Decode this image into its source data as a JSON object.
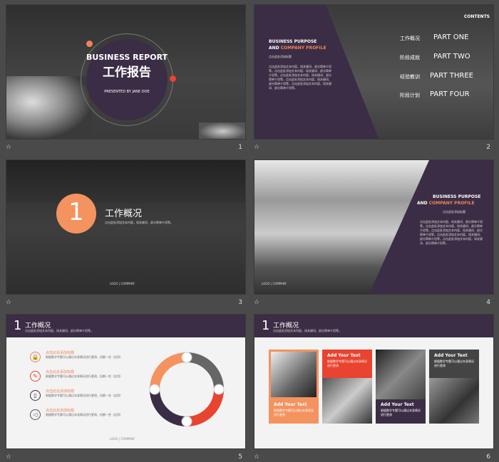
{
  "slides": [
    {
      "num": "1",
      "title_en": "BUSINESS REPORT",
      "title_cn": "工作报告",
      "presenter": "PRESENTED  BY  JANE  DOE"
    },
    {
      "num": "2",
      "contents": "CONTENTS",
      "heading1": "BUSINESS PURPOSE",
      "heading2a": "AND",
      "heading2b": "COMPANY PROFILE",
      "desc": "点击此处添加标题",
      "body": "点击此处添加文本内容，如关键词、部分简单介绍等。点击此处添加文本内容，如关键词、部分简单介绍等。点击此处添加文本内容，如关键词、部分简单介绍等。点击此处添加文本内容，如关键词、部分简单介绍等。点击此处添加文本内容，如关键词、部分简单介绍等。",
      "items": [
        {
          "cn": "工作概况",
          "en": "PART ONE"
        },
        {
          "cn": "阶段成就",
          "en": "PART TWO"
        },
        {
          "cn": "经验教训",
          "en": "PART THREE"
        },
        {
          "cn": "阶段计划",
          "en": "PART FOUR"
        }
      ]
    },
    {
      "num": "3",
      "big": "1",
      "title": "工作概况",
      "sub": "点击此处添加文本内容，如关键词、部分简单介绍等。",
      "logo": "LOGO  |  COMPANY"
    },
    {
      "num": "4",
      "heading1": "BUSINESS PURPOSE",
      "heading2a": "AND",
      "heading2b": "COMPANY PROFILE",
      "desc": "点击此处添加标题",
      "body": "点击此处添加文本内容，如关键词、部分简单介绍等。点击此处添加文本内容，如关键词、部分简单介绍等。点击此处添加文本内容，如关键词、部分简单介绍等。点击此处添加文本内容，如关键词、部分简单介绍等。点击此处添加文本内容，如关键词、部分简单介绍等。",
      "logo": "LOGO  |  COMPANY"
    },
    {
      "num": "5",
      "big": "1",
      "title": "工作概况",
      "sub": "点击此处添加文本内容，如关键词、部分简单介绍等。",
      "logo": "LOGO  |  COMPANY",
      "items": [
        {
          "head": "点击此处添加标题",
          "body": "根据数学专题可以通过本身情况进行更改，但都一些（应用）"
        },
        {
          "head": "点击此处添加标题",
          "body": "根据数学专题可以通过本身情况进行更改，但都一些（应用）"
        },
        {
          "head": "点击此处添加标题",
          "body": "根据数学专题可以通过本身情况进行更改，但都一些（应用）"
        },
        {
          "head": "点击此处添加标题",
          "body": "根据数学专题可以通过本身情况进行更改，但都一些（应用）"
        }
      ]
    },
    {
      "num": "6",
      "big": "1",
      "title": "工作概况",
      "sub": "点击此处添加文本内容，如关键词、部分简单介绍等。",
      "cards": [
        {
          "label": "Add Your Text",
          "body": "根据数学专题可以通过本身情况进行更改"
        },
        {
          "label": "Add Your Text",
          "body": "根据数学专题可以通过本身情况进行更改"
        },
        {
          "label": "Add Your Text",
          "body": "根据数学专题可以通过本身情况进行更改"
        },
        {
          "label": "Add Your Text",
          "body": "根据数学专题可以通过本身情况进行更改"
        }
      ]
    }
  ]
}
